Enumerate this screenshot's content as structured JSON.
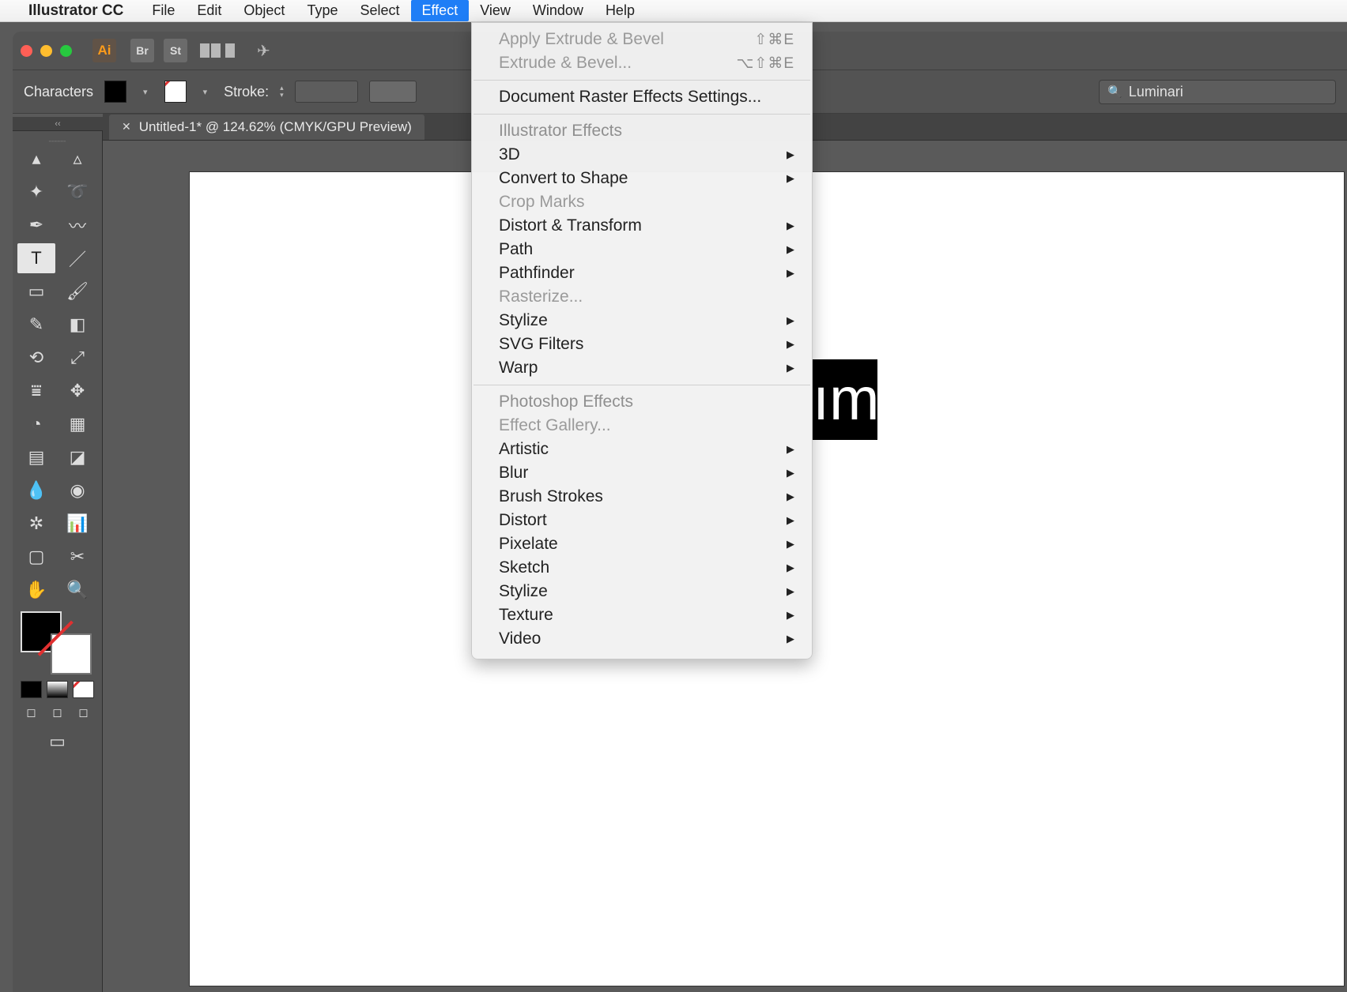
{
  "menubar": {
    "appname": "Illustrator CC",
    "items": [
      "File",
      "Edit",
      "Object",
      "Type",
      "Select",
      "Effect",
      "View",
      "Window",
      "Help"
    ],
    "active": "Effect"
  },
  "topbar": {
    "badges": [
      "Br",
      "St"
    ]
  },
  "ctrlbar": {
    "mode_label": "Characters",
    "stroke_label": "Stroke:",
    "search_placeholder": "",
    "search_value": "Luminari"
  },
  "tab": {
    "title": "Untitled-1* @ 124.62% (CMYK/GPU Preview)"
  },
  "canvas": {
    "black_text": "ım"
  },
  "dropdown": {
    "recent": [
      {
        "label": "Apply Extrude & Bevel",
        "shortcut": "⇧⌘E",
        "disabled": true
      },
      {
        "label": "Extrude & Bevel...",
        "shortcut": "⌥⇧⌘E",
        "disabled": true
      }
    ],
    "raster": {
      "label": "Document Raster Effects Settings..."
    },
    "il_header": "Illustrator Effects",
    "il_items": [
      {
        "label": "3D",
        "sub": true
      },
      {
        "label": "Convert to Shape",
        "sub": true
      },
      {
        "label": "Crop Marks",
        "disabled": true
      },
      {
        "label": "Distort & Transform",
        "sub": true
      },
      {
        "label": "Path",
        "sub": true
      },
      {
        "label": "Pathfinder",
        "sub": true
      },
      {
        "label": "Rasterize...",
        "disabled": true
      },
      {
        "label": "Stylize",
        "sub": true
      },
      {
        "label": "SVG Filters",
        "sub": true
      },
      {
        "label": "Warp",
        "sub": true
      }
    ],
    "ps_header": "Photoshop Effects",
    "ps_gallery": {
      "label": "Effect Gallery...",
      "disabled": true
    },
    "ps_items": [
      {
        "label": "Artistic",
        "sub": true
      },
      {
        "label": "Blur",
        "sub": true
      },
      {
        "label": "Brush Strokes",
        "sub": true
      },
      {
        "label": "Distort",
        "sub": true
      },
      {
        "label": "Pixelate",
        "sub": true
      },
      {
        "label": "Sketch",
        "sub": true
      },
      {
        "label": "Stylize",
        "sub": true
      },
      {
        "label": "Texture",
        "sub": true
      },
      {
        "label": "Video",
        "sub": true
      }
    ]
  }
}
